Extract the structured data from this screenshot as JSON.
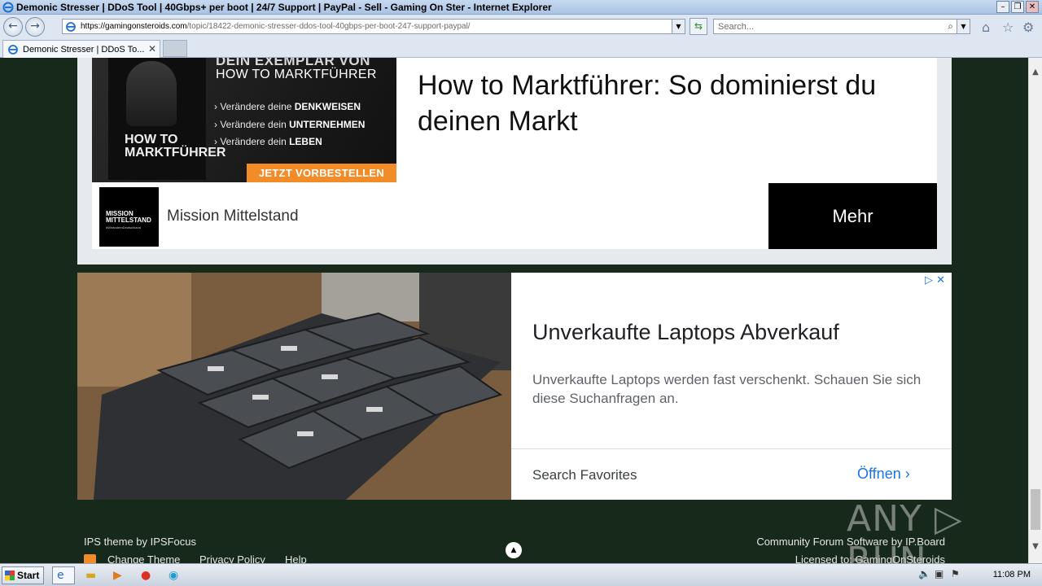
{
  "window": {
    "title": "Demonic Stresser | DDoS Tool | 40Gbps+ per boot | 24/7 Support | PayPal - Sell - Gaming On Ster - Internet Explorer",
    "minimize": "–",
    "restore": "❐",
    "close": "✕"
  },
  "toolbar": {
    "back": "←",
    "forward": "→",
    "url_host": "https://gamingonsteroids.com",
    "url_path": "/topic/18422-demonic-stresser-ddos-tool-40gbps-per-boot-247-support-paypal/",
    "search_placeholder": "Search...",
    "home_icon": "⌂",
    "favorites_icon": "☆",
    "tools_icon": "⚙"
  },
  "tab": {
    "label": "Demonic Stresser | DDoS To...",
    "close": "✕"
  },
  "ad1": {
    "book_exemplar": "DEIN EXEMPLAR VON",
    "book_howto": "HOW TO MARKTFÜHRER",
    "bullets": [
      {
        "prefix": "Verändere deine ",
        "bold": "DENKWEISEN"
      },
      {
        "prefix": "Verändere dein ",
        "bold": "UNTERNEHMEN"
      },
      {
        "prefix": "Verändere dein ",
        "bold": "LEBEN"
      }
    ],
    "cover_text": "HOW TO MARKTFÜHRER",
    "cta": "JETZT VORBESTELLEN",
    "headline": "How to Marktführer: So dominierst du deinen Markt",
    "logo_line1": "MISSION MITTELSTAND",
    "logo_line2": "#WirändernDeutschland",
    "brand": "Mission Mittelstand",
    "button": "Mehr"
  },
  "ad2": {
    "adchoices": "▷ ✕",
    "headline": "Unverkaufte Laptops Abverkauf",
    "description": "Unverkaufte Laptops werden fast verschenkt. Schauen Sie sich diese Suchanfragen an.",
    "footer_label": "Search Favorites",
    "open_label": "Öffnen ›"
  },
  "footer": {
    "theme_credit": "IPS theme by IPSFocus",
    "links": [
      "Change Theme",
      "Privacy Policy",
      "Help"
    ],
    "software_credit": "Community Forum Software by IP.Board",
    "license": "Licensed to: GamingOnSteroids",
    "totop": "▲"
  },
  "watermark": "ANY ▷ RUN",
  "taskbar": {
    "start": "Start",
    "clock": "11:08 PM"
  },
  "colors": {
    "page_bg": "#16291a",
    "cta_orange": "#f28c28",
    "google_blue": "#1a73e8"
  }
}
